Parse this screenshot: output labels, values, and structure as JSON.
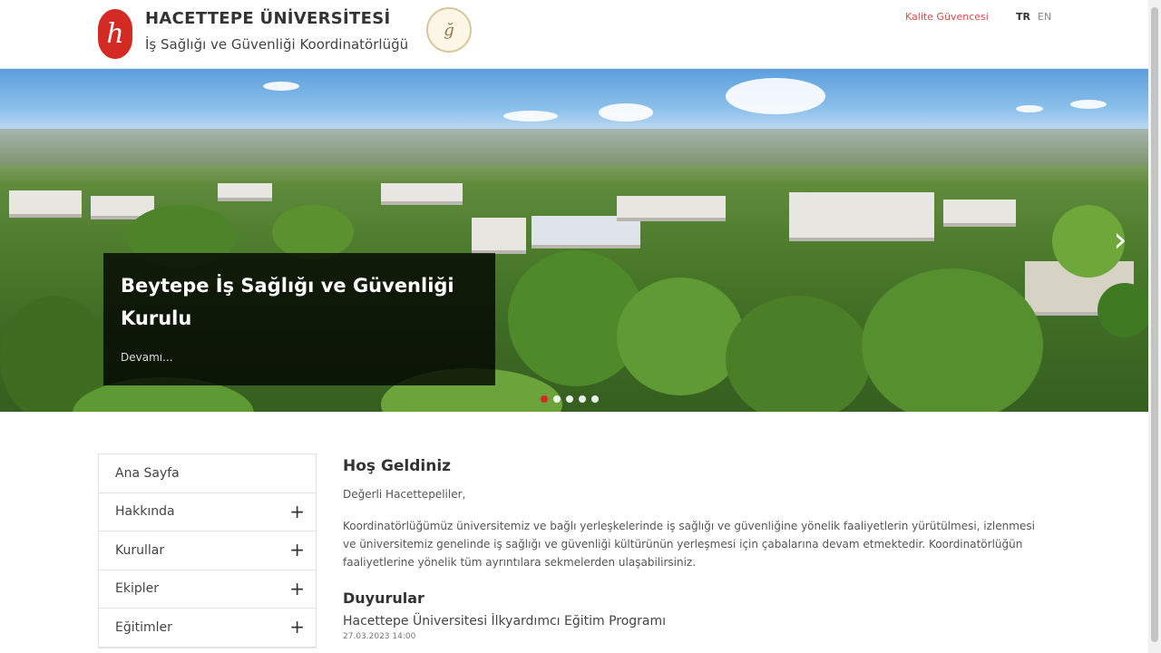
{
  "header": {
    "logo_letter": "h",
    "university": "HACETTEPE ÜNİVERSİTESİ",
    "unit": "İş Sağlığı ve Güvenliği Koordinatörlüğü",
    "seal_letter": "ğ",
    "quality_link": "Kalite Güvencesi",
    "lang_tr": "TR",
    "lang_en": "EN"
  },
  "hero": {
    "caption_title": "Beytepe İş Sağlığı ve Güvenliği Kurulu",
    "caption_more": "Devamı...",
    "next_arrow": "›",
    "slides_count": 5,
    "active_slide": 1
  },
  "sidebar": {
    "items": [
      {
        "label": "Ana Sayfa",
        "expand": ""
      },
      {
        "label": "Hakkında",
        "expand": "+"
      },
      {
        "label": "Kurullar",
        "expand": "+"
      },
      {
        "label": "Ekipler",
        "expand": "+"
      },
      {
        "label": "Eğitimler",
        "expand": "+"
      }
    ]
  },
  "content": {
    "welcome_title": "Hoş Geldiniz",
    "greeting": "Değerli Hacettepeliler,",
    "body": "Koordinatörlüğümüz üniversitemiz ve bağlı yerleşkelerinde iş sağlığı ve güvenliğine yönelik faaliyetlerin yürütülmesi, izlenmesi ve üniversitemiz genelinde iş sağlığı ve güvenliği kültürünün yerleşmesi için çabalarına devam etmektedir. Koordinatörlüğün faaliyetlerine yönelik tüm ayrıntılara sekmelerden ulaşabilirsiniz.",
    "news_title": "Duyurular",
    "news": [
      {
        "title": "Hacettepe Üniversitesi İlkyardımcı Eğitim Programı",
        "date": "27.03.2023 14:00"
      }
    ]
  },
  "colors": {
    "brand_red": "#d42a24",
    "caption_bg": "#000000",
    "link_red": "#e4484a"
  }
}
